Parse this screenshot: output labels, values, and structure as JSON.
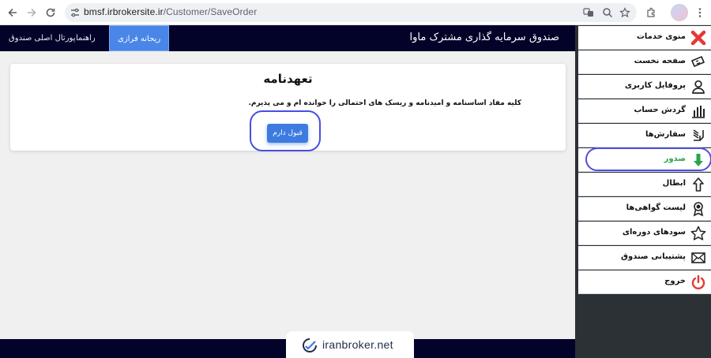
{
  "browser": {
    "url_host": "bmsf.irbrokersite.ir",
    "url_path": "/Customer/SaveOrder"
  },
  "header": {
    "title": "صندوق سرمایه گذاری مشترک ماوا",
    "links": [
      {
        "label": "ریحانه فرازی",
        "active": true
      },
      {
        "label": "راهنما",
        "active": false
      },
      {
        "label": "پورتال اصلی صندوق",
        "active": false
      }
    ]
  },
  "card": {
    "title": "تعهدنامه",
    "text": "کلیه مفاد اساسنامه و امیدنامه و ریسک های احتمالی را خوانده ام و می پذیرم.",
    "accept_label": "قبول دارم"
  },
  "sidebar": {
    "items": [
      {
        "label": "منوی خدمات",
        "icon": "close-icon",
        "color": "#e53935"
      },
      {
        "label": "صفحه نخست",
        "icon": "ticket-icon",
        "color": "#222222"
      },
      {
        "label": "پروفایل کاربری",
        "icon": "user-icon",
        "color": "#222222"
      },
      {
        "label": "گردش حساب",
        "icon": "bar-chart-icon",
        "color": "#222222"
      },
      {
        "label": "سفارش‌ها",
        "icon": "list-hand-icon",
        "color": "#222222"
      },
      {
        "label": "صدور",
        "icon": "arrow-down-icon",
        "color": "#2aa44a",
        "active": true
      },
      {
        "label": "ابطال",
        "icon": "arrow-up-icon",
        "color": "#222222"
      },
      {
        "label": "لیست گواهی‌ها",
        "icon": "award-icon",
        "color": "#222222"
      },
      {
        "label": "سودهای دوره‌ای",
        "icon": "star-icon",
        "color": "#222222"
      },
      {
        "label": "پشتیبانی صندوق",
        "icon": "mail-icon",
        "color": "#222222"
      },
      {
        "label": "خروج",
        "icon": "power-icon",
        "color": "#e53935"
      }
    ]
  },
  "footer": {
    "brand": "iranbroker.net"
  }
}
